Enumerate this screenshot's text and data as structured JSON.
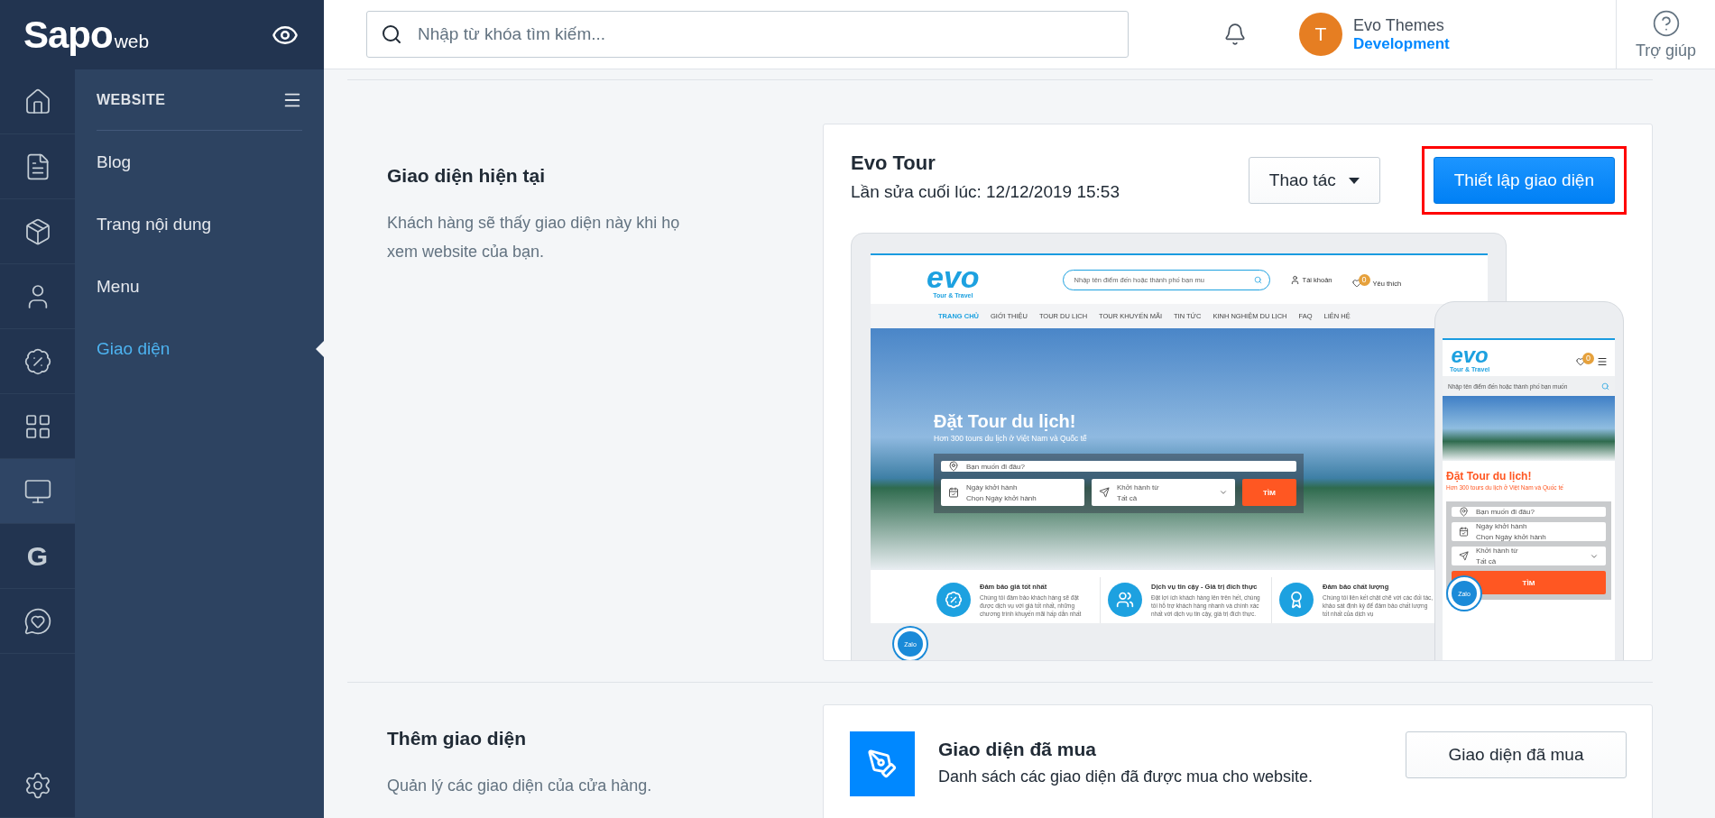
{
  "topbar": {
    "logo": "Sapo",
    "logo_suffix": "web",
    "search": {
      "placeholder": "Nhập từ khóa tìm kiếm..."
    },
    "user": {
      "initial": "T",
      "name": "Evo Themes",
      "role": "Development"
    },
    "help": "Trợ giúp"
  },
  "rail": [
    {
      "kind": "home",
      "selected": false
    },
    {
      "kind": "orders",
      "selected": false
    },
    {
      "kind": "products",
      "selected": false
    },
    {
      "kind": "customers",
      "selected": false
    },
    {
      "kind": "discounts",
      "selected": false
    },
    {
      "kind": "apps",
      "selected": false
    },
    {
      "kind": "website",
      "selected": true
    },
    {
      "kind": "letter",
      "text": "G",
      "selected": false
    },
    {
      "kind": "chat",
      "selected": false
    },
    {
      "kind": "settings",
      "selected": false
    }
  ],
  "nav": {
    "title": "WEBSITE",
    "items": [
      {
        "label": "Blog",
        "selected": false
      },
      {
        "label": "Trang nội dung",
        "selected": false
      },
      {
        "label": "Menu",
        "selected": false
      },
      {
        "label": "Giao diện",
        "selected": true
      }
    ]
  },
  "current": {
    "title": "Giao diện hiện tại",
    "description": "Khách hàng sẽ thấy giao diện này khi họ xem website của bạn.",
    "theme_name": "Evo Tour",
    "last_edited": "Lần sửa cuối lúc: 12/12/2019 15:53",
    "actions_button": "Thao tác",
    "customize_button": "Thiết lập giao diện",
    "preview": {
      "desktop": {
        "logo": "evo",
        "logo_sub": "Tour & Travel",
        "search_placeholder": "Nhập tên điểm đến hoặc thành phố bạn mu",
        "account": "Tài khoản",
        "wishlist": "Yêu thích",
        "wishlist_count": "0",
        "menu": [
          {
            "label": "TRANG CHỦ",
            "selected": true
          },
          {
            "label": "GIỚI THIỆU",
            "selected": false
          },
          {
            "label": "TOUR DU LỊCH",
            "selected": false
          },
          {
            "label": "TOUR KHUYẾN MÃI",
            "selected": false
          },
          {
            "label": "TIN TỨC",
            "selected": false
          },
          {
            "label": "KINH NGHIỆM DU LỊCH",
            "selected": false
          },
          {
            "label": "FAQ",
            "selected": false
          },
          {
            "label": "LIÊN HỆ",
            "selected": false
          }
        ],
        "hero_title": "Đặt Tour du lịch!",
        "hero_subtitle": "Hơn 300 tours du lịch ở Việt Nam và Quốc tế",
        "destination_placeholder": "Bạn muốn đi đâu?",
        "date_label": "Ngày khởi hành",
        "date_value": "Chọn Ngày khởi hành",
        "depart_label": "Khởi hành từ",
        "depart_value": "Tất cả",
        "search_button": "TÌM",
        "features": [
          {
            "kind": "price",
            "title": "Đảm bảo giá tốt nhất",
            "text": "Chúng tôi đảm bảo khách hàng sẽ đặt được dịch vụ với giá tốt nhất, những chương trình khuyến mãi hấp dẫn nhất"
          },
          {
            "kind": "service",
            "title": "Dịch vụ tin cậy - Giá trị đích thực",
            "text": "Đặt lợi ích khách hàng lên trên hết, chúng tôi hỗ trợ khách hàng nhanh và chính xác nhất với dịch vụ tin cậy, giá trị đích thực."
          },
          {
            "kind": "quality",
            "title": "Đảm bảo chất lượng",
            "text": "Chúng tôi liên kết chặt chẽ với các đối tác, khảo sát định kỳ để đảm bảo chất lượng tốt nhất của dịch vụ"
          }
        ],
        "chat_widget": "Zalo"
      },
      "mobile": {
        "logo": "evo",
        "logo_sub": "Tour & Travel",
        "wishlist_count": "0",
        "search_placeholder": "Nhập tên điểm đến hoặc thành phố bạn muốn",
        "hero_title": "Đặt Tour du lịch!",
        "hero_subtitle": "Hơn 300 tours du lịch ở Việt Nam và Quốc tế",
        "destination_placeholder": "Bạn muốn đi đâu?",
        "date_label": "Ngày khởi hành",
        "date_value": "Chọn Ngày khởi hành",
        "depart_label": "Khởi hành từ",
        "depart_value": "Tất cả",
        "search_button": "TÌM",
        "chat_widget": "Zalo"
      }
    }
  },
  "add": {
    "title": "Thêm giao diện",
    "description": "Quản lý các giao diện của cửa hàng.",
    "purchased_title": "Giao diện đã mua",
    "purchased_description": "Danh sách các giao diện đã được mua cho website.",
    "purchased_button": "Giao diện đã mua"
  }
}
